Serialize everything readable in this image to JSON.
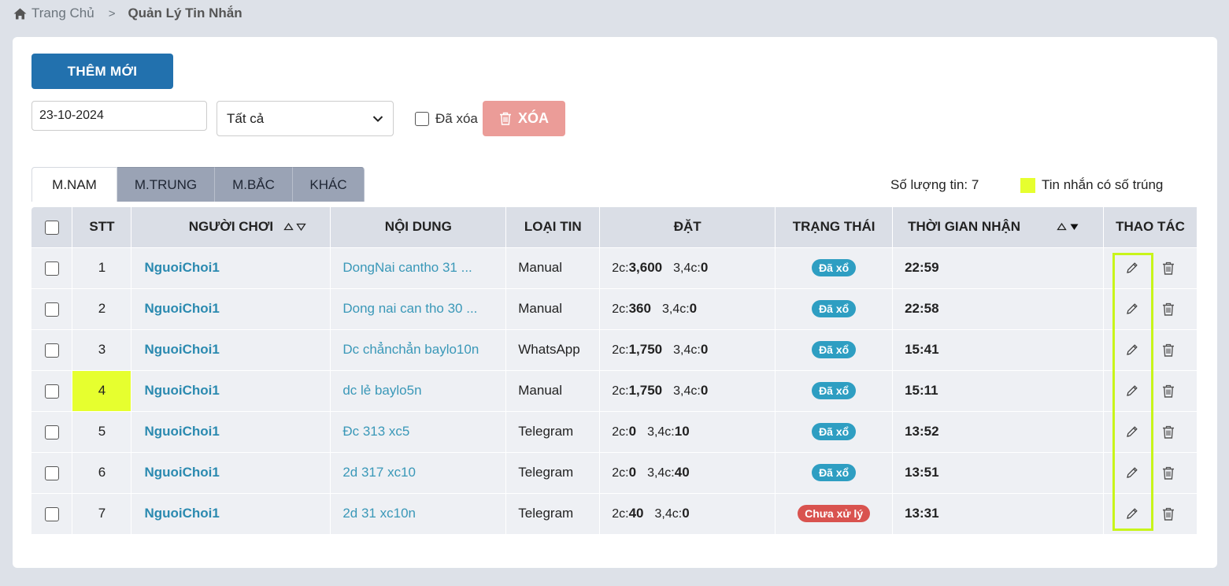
{
  "breadcrumb": {
    "home": "Trang Chủ",
    "separator": ">",
    "current": "Quản Lý Tin Nhắn"
  },
  "toolbar": {
    "add_label": "THÊM MỚI",
    "date_value": "23-10-2024",
    "filter_selected": "Tất cả",
    "deleted_label": "Đã xóa",
    "delete_label": "XÓA"
  },
  "tabs": [
    {
      "label": "M.NAM",
      "active": true
    },
    {
      "label": "M.TRUNG",
      "active": false
    },
    {
      "label": "M.BẮC",
      "active": false
    },
    {
      "label": "KHÁC",
      "active": false
    }
  ],
  "summary": {
    "count_text": "Số lượng tin: 7",
    "legend_text": "Tin nhắn có số trúng",
    "legend_color": "#e6ff2f"
  },
  "table": {
    "headers": {
      "stt": "STT",
      "player": "NGƯỜI CHƠI",
      "content": "NỘI DUNG",
      "type": "LOẠI TIN",
      "bet": "ĐẶT",
      "status": "TRẠNG THÁI",
      "time": "THỜI GIAN NHẬN",
      "actions": "THAO TÁC"
    },
    "bet_labels": {
      "two": "2c:",
      "three_four": "3,4c:"
    },
    "rows": [
      {
        "stt": "1",
        "player": "NguoiChoi1",
        "content": "DongNai cantho 31 ...",
        "type": "Manual",
        "bet2": "3,600",
        "bet34": "0",
        "status": "Đã xổ",
        "time": "22:59",
        "highlight": false
      },
      {
        "stt": "2",
        "player": "NguoiChoi1",
        "content": "Dong nai can tho 30 ...",
        "type": "Manual",
        "bet2": "360",
        "bet34": "0",
        "status": "Đã xổ",
        "time": "22:58",
        "highlight": false
      },
      {
        "stt": "3",
        "player": "NguoiChoi1",
        "content": "Dc chẳnchẳn baylo10n",
        "type": "WhatsApp",
        "bet2": "1,750",
        "bet34": "0",
        "status": "Đã xổ",
        "time": "15:41",
        "highlight": false
      },
      {
        "stt": "4",
        "player": "NguoiChoi1",
        "content": "dc lẻ baylo5n",
        "type": "Manual",
        "bet2": "1,750",
        "bet34": "0",
        "status": "Đã xổ",
        "time": "15:11",
        "highlight": true
      },
      {
        "stt": "5",
        "player": "NguoiChoi1",
        "content": "Đc 313 xc5",
        "type": "Telegram",
        "bet2": "0",
        "bet34": "10",
        "status": "Đã xổ",
        "time": "13:52",
        "highlight": false
      },
      {
        "stt": "6",
        "player": "NguoiChoi1",
        "content": "2d 317 xc10",
        "type": "Telegram",
        "bet2": "0",
        "bet34": "40",
        "status": "Đã xổ",
        "time": "13:51",
        "highlight": false
      },
      {
        "stt": "7",
        "player": "NguoiChoi1",
        "content": "2d 31 xc10n",
        "type": "Telegram",
        "bet2": "40",
        "bet34": "0",
        "status": "Chưa xử lý",
        "time": "13:31",
        "highlight": false
      }
    ]
  }
}
